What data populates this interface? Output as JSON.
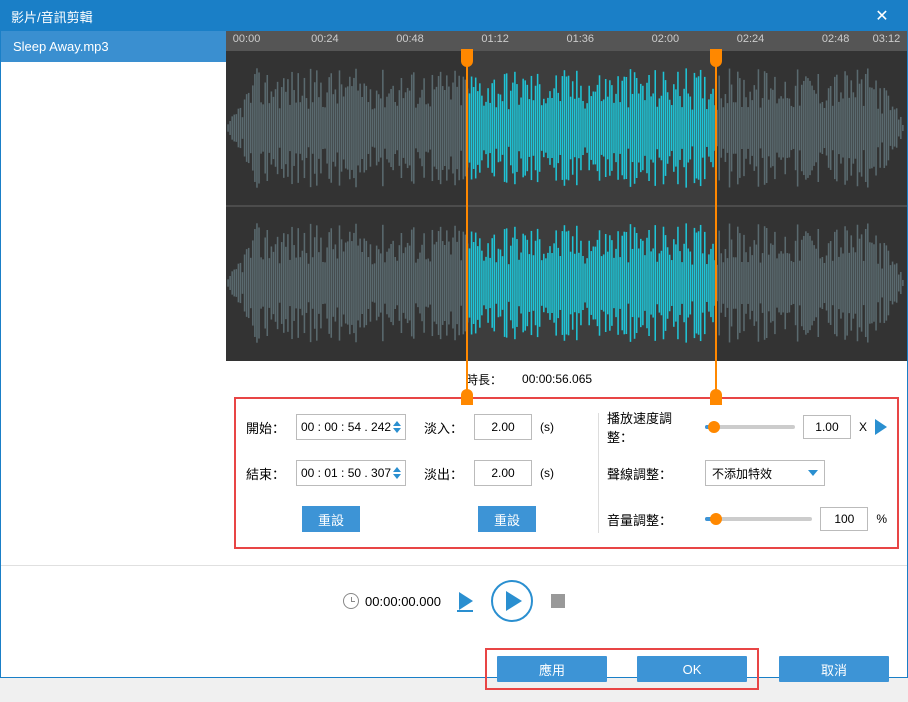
{
  "window": {
    "title": "影片/音訊剪輯"
  },
  "sidebar": {
    "items": [
      {
        "label": "Sleep Away.mp3"
      }
    ]
  },
  "ruler": {
    "ticks": [
      "00:00",
      "00:24",
      "00:48",
      "01:12",
      "01:36",
      "02:00",
      "02:24",
      "02:48",
      "03:12"
    ]
  },
  "selection": {
    "left_pct": 35.3,
    "right_pct": 71.8
  },
  "duration": {
    "label": "時長：",
    "value": "00:00:56.065"
  },
  "controls": {
    "start": {
      "label": "開始：",
      "value": "00 : 00 : 54 . 242"
    },
    "end": {
      "label": "結束：",
      "value": "00 : 01 : 50 . 307"
    },
    "reset1": "重設",
    "fadein": {
      "label": "淡入：",
      "value": "2.00",
      "suffix": "(s)"
    },
    "fadeout": {
      "label": "淡出：",
      "value": "2.00",
      "suffix": "(s)"
    },
    "reset2": "重設",
    "speed": {
      "label": "播放速度調整：",
      "value": "1.00",
      "suffix": "X",
      "pct": 10
    },
    "sound": {
      "label": "聲線調整：",
      "value": "不添加特效"
    },
    "volume": {
      "label": "音量調整：",
      "value": "100",
      "suffix": "%",
      "pct": 10
    }
  },
  "playback": {
    "time": "00:00:00.000"
  },
  "footer": {
    "apply": "應用",
    "ok": "OK",
    "cancel": "取消"
  }
}
